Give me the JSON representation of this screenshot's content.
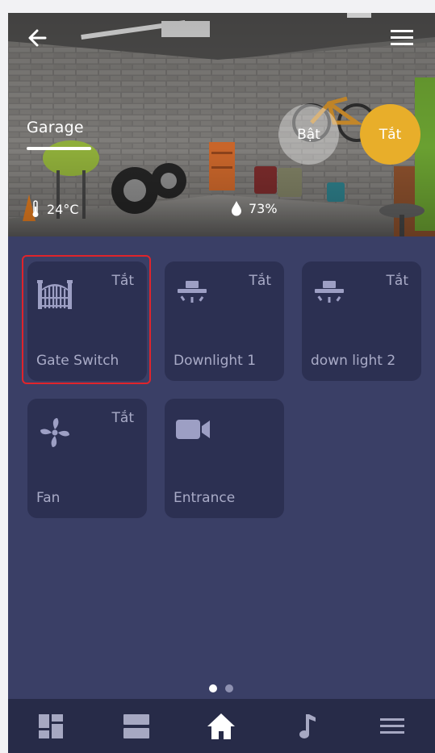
{
  "header": {
    "room_name": "Garage",
    "toggle_on_label": "Bật",
    "toggle_off_label": "Tắt",
    "temperature": "24°C",
    "humidity": "73%"
  },
  "devices": [
    {
      "name": "Gate Switch",
      "state": "Tắt",
      "icon": "gate-icon",
      "selected": true
    },
    {
      "name": "Downlight 1",
      "state": "Tắt",
      "icon": "downlight-icon"
    },
    {
      "name": "down light 2",
      "state": "Tắt",
      "icon": "downlight-icon"
    },
    {
      "name": "Fan",
      "state": "Tắt",
      "icon": "fan-icon"
    },
    {
      "name": "Entrance",
      "state": "",
      "icon": "camera-icon"
    }
  ],
  "pager": {
    "pages": 2,
    "current": 1
  },
  "bottom_nav": [
    "dashboard-icon",
    "rooms-icon",
    "home-icon",
    "music-icon",
    "menu-icon"
  ],
  "colors": {
    "accent": "#e8ae2a",
    "tile": "#2c3052",
    "background": "#3a3f66",
    "selection": "#e0242b"
  }
}
